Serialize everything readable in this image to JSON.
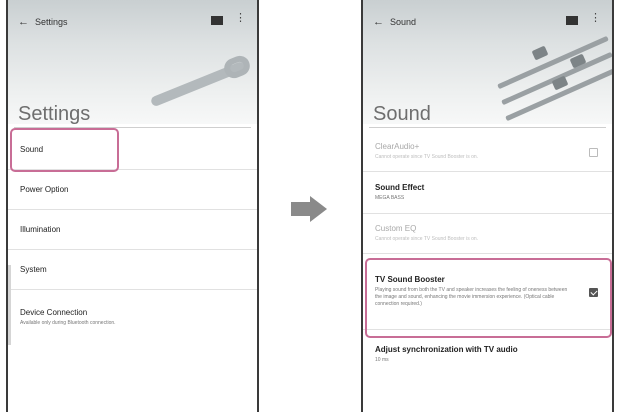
{
  "left_screen": {
    "topbar_title": "Settings",
    "header_title": "Settings",
    "items": [
      {
        "title": "Sound",
        "subtitle": ""
      },
      {
        "title": "Power Option",
        "subtitle": ""
      },
      {
        "title": "Illumination",
        "subtitle": ""
      },
      {
        "title": "System",
        "subtitle": ""
      },
      {
        "title": "Device Connection",
        "subtitle": "Available only during Bluetooth connection."
      }
    ],
    "highlighted_item": "Sound"
  },
  "right_screen": {
    "topbar_title": "Sound",
    "header_title": "Sound",
    "items": [
      {
        "title": "ClearAudio+",
        "subtitle": "Cannot operate since TV Sound Booster is on.",
        "state": "disabled",
        "checkbox": "unchecked"
      },
      {
        "title": "Sound Effect",
        "subtitle": "MEGA BASS",
        "state": "enabled"
      },
      {
        "title": "Custom EQ",
        "subtitle": "Cannot operate since TV Sound Booster is on.",
        "state": "disabled"
      },
      {
        "title": "TV Sound Booster",
        "subtitle": "Playing sound from both the TV and speaker increases the feeling of oneness between the image and sound, enhancing the movie immersion experience. (Optical cable connection required.)",
        "state": "enabled",
        "checkbox": "checked"
      },
      {
        "title": "Adjust synchronization with TV audio",
        "subtitle": "10 ms",
        "state": "enabled"
      }
    ],
    "highlighted_item": "TV Sound Booster"
  },
  "icons": {
    "back": "back-arrow-icon",
    "record": "record-icon",
    "menu": "kebab-menu-icon",
    "transition": "right-arrow-icon"
  },
  "colors": {
    "highlight": "#c86d96",
    "arrow": "#8a8a8a"
  }
}
